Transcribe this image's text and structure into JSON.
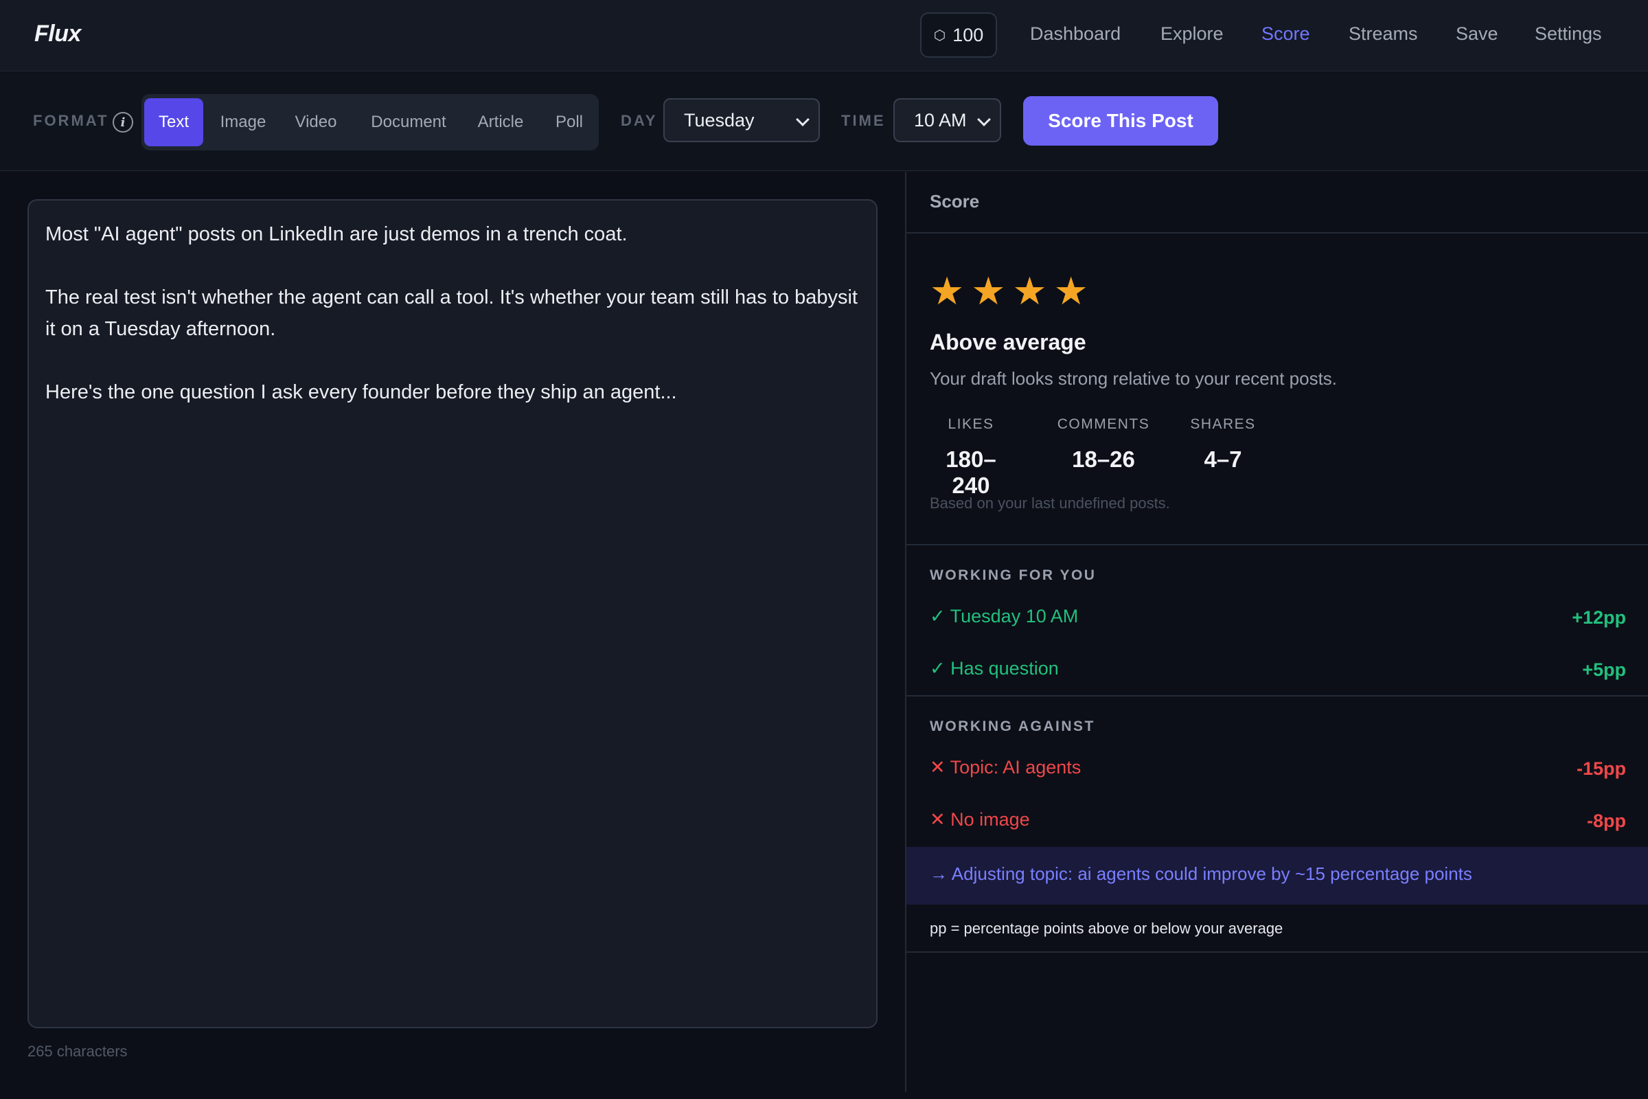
{
  "app": {
    "name": "Flux"
  },
  "nav": {
    "credits": "100",
    "credits_icon": "hexagon-icon",
    "links": [
      "Dashboard",
      "Explore",
      "Score",
      "Streams",
      "Save",
      "Settings"
    ],
    "active": "Score",
    "active_color": "#7276ff"
  },
  "toolbar": {
    "format_label": "FORMAT",
    "format_options": [
      "Text",
      "Image",
      "Video",
      "Document",
      "Article",
      "Poll"
    ],
    "format_selected": "Text",
    "day_label": "DAY",
    "day_value": "Tuesday",
    "time_label": "TIME",
    "time_value": "10 AM",
    "score_button": "Score This Post",
    "accent_color": "#6c63f5"
  },
  "editor": {
    "paragraphs": [
      "Most \"AI agent\" posts on LinkedIn are just demos in a trench coat.",
      "The real test isn't whether the agent can call a tool. It's whether your team still has to babysit it on a Tuesday afternoon.",
      "Here's the one question I ask every founder before they ship an agent..."
    ],
    "char_count": "265 characters"
  },
  "score": {
    "title": "Score",
    "stars": 4,
    "star_color": "#f5a524",
    "rating_label": "Above average",
    "rating_desc": "Your draft looks strong relative to your recent posts.",
    "metrics": [
      {
        "label": "LIKES",
        "value": "180–240"
      },
      {
        "label": "COMMENTS",
        "value": "18–26"
      },
      {
        "label": "SHARES",
        "value": "4–7"
      }
    ],
    "based_on": "Based on your last undefined posts.",
    "working_for": {
      "heading": "WORKING FOR YOU",
      "items": [
        {
          "label": "✓ Tuesday 10 AM",
          "impact": "+12pp"
        },
        {
          "label": "✓ Has question",
          "impact": "+5pp"
        }
      ],
      "color": "#22c07e"
    },
    "working_against": {
      "heading": "WORKING AGAINST",
      "items": [
        {
          "label": "✕ Topic: AI agents",
          "impact": "-15pp"
        },
        {
          "label": "✕ No image",
          "impact": "-8pp"
        }
      ],
      "color": "#f0474a"
    },
    "suggestion": "→ Adjusting topic: ai agents could improve by ~15 percentage points",
    "footnote": "pp = percentage points above or below your average"
  }
}
